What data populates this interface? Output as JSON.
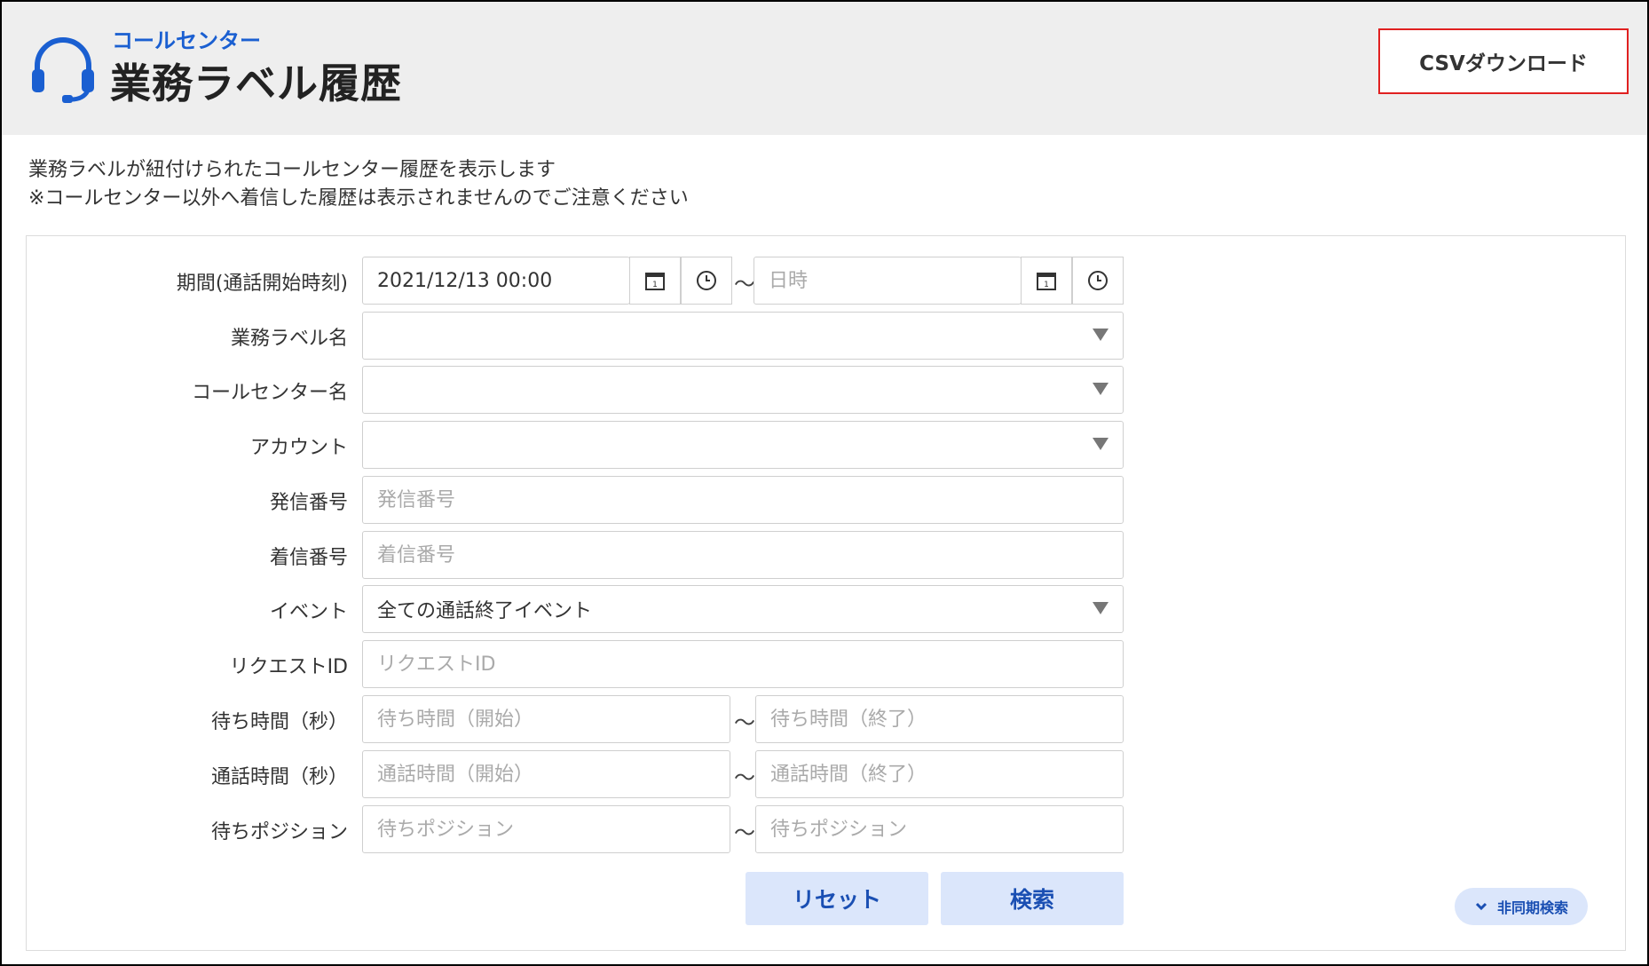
{
  "header": {
    "app_name": "コールセンター",
    "title": "業務ラベル履歴",
    "csv_button": "CSVダウンロード",
    "logo_icon": "headset-icon"
  },
  "description": {
    "line1": "業務ラベルが紐付けられたコールセンター履歴を表示します",
    "line2": "※コールセンター以外へ着信した履歴は表示されませんのでご注意ください"
  },
  "form": {
    "period": {
      "label": "期間(通話開始時刻)",
      "start_value": "2021/12/13 00:00",
      "end_placeholder": "日時",
      "separator": "〜"
    },
    "business_label": {
      "label": "業務ラベル名",
      "value": ""
    },
    "call_center": {
      "label": "コールセンター名",
      "value": ""
    },
    "account": {
      "label": "アカウント",
      "value": ""
    },
    "caller_number": {
      "label": "発信番号",
      "placeholder": "発信番号"
    },
    "callee_number": {
      "label": "着信番号",
      "placeholder": "着信番号"
    },
    "event": {
      "label": "イベント",
      "value": "全ての通話終了イベント"
    },
    "request_id": {
      "label": "リクエストID",
      "placeholder": "リクエストID"
    },
    "wait_time": {
      "label": "待ち時間（秒）",
      "start_placeholder": "待ち時間（開始）",
      "end_placeholder": "待ち時間（終了）",
      "separator": "〜"
    },
    "talk_time": {
      "label": "通話時間（秒）",
      "start_placeholder": "通話時間（開始）",
      "end_placeholder": "通話時間（終了）",
      "separator": "〜"
    },
    "wait_position": {
      "label": "待ちポジション",
      "start_placeholder": "待ちポジション",
      "end_placeholder": "待ちポジション",
      "separator": "〜"
    }
  },
  "buttons": {
    "reset": "リセット",
    "search": "検索",
    "async_search": "非同期検索"
  },
  "colors": {
    "accent": "#1a5fd1",
    "button_bg": "#dbe6fb",
    "header_bg": "#eeeeee",
    "csv_border": "#e02020"
  }
}
